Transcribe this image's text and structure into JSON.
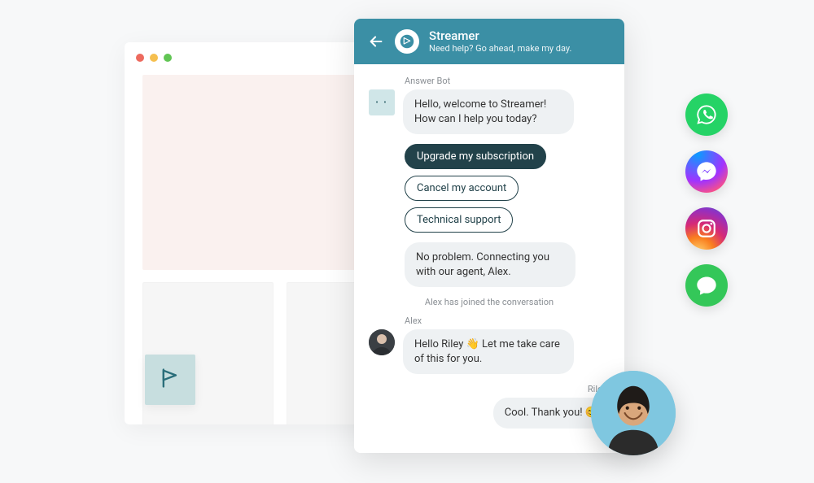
{
  "colors": {
    "header_bg": "#3b8fa5",
    "chip_dark": "#22424a",
    "bot_avatar_bg": "#d0e6e8",
    "hero_bg": "#faf1ef",
    "launcher_bg": "#c7dedf",
    "whatsapp": "#25d366",
    "sms": "#34c759"
  },
  "browser_mock": {
    "traffic_lights": [
      "red",
      "yellow",
      "green"
    ]
  },
  "launcher": {
    "icon": "flag-icon"
  },
  "chat": {
    "header": {
      "back_icon": "arrow-left-icon",
      "brand_icon": "streamer-logo-icon",
      "title": "Streamer",
      "subtitle": "Need help? Go ahead, make my day."
    },
    "bot_name": "Answer Bot",
    "bot_greeting": "Hello, welcome to Streamer! How can I help you today?",
    "quick_replies": [
      {
        "label": "Upgrade my subscription",
        "selected": true
      },
      {
        "label": "Cancel my account",
        "selected": false
      },
      {
        "label": "Technical support",
        "selected": false
      }
    ],
    "bot_followup": "No problem. Connecting you with our agent, Alex.",
    "system_notice": "Alex has joined the conversation",
    "agent_name": "Alex",
    "agent_message": "Hello Riley 👋 Let me take care of this for you.",
    "user_name": "Riley",
    "user_message": "Cool. Thank you! 😊"
  },
  "channels": [
    {
      "name": "whatsapp",
      "icon": "whatsapp-icon"
    },
    {
      "name": "messenger",
      "icon": "messenger-icon"
    },
    {
      "name": "instagram",
      "icon": "instagram-icon"
    },
    {
      "name": "sms",
      "icon": "sms-icon"
    }
  ],
  "float_avatar": {
    "name": "user-avatar"
  }
}
